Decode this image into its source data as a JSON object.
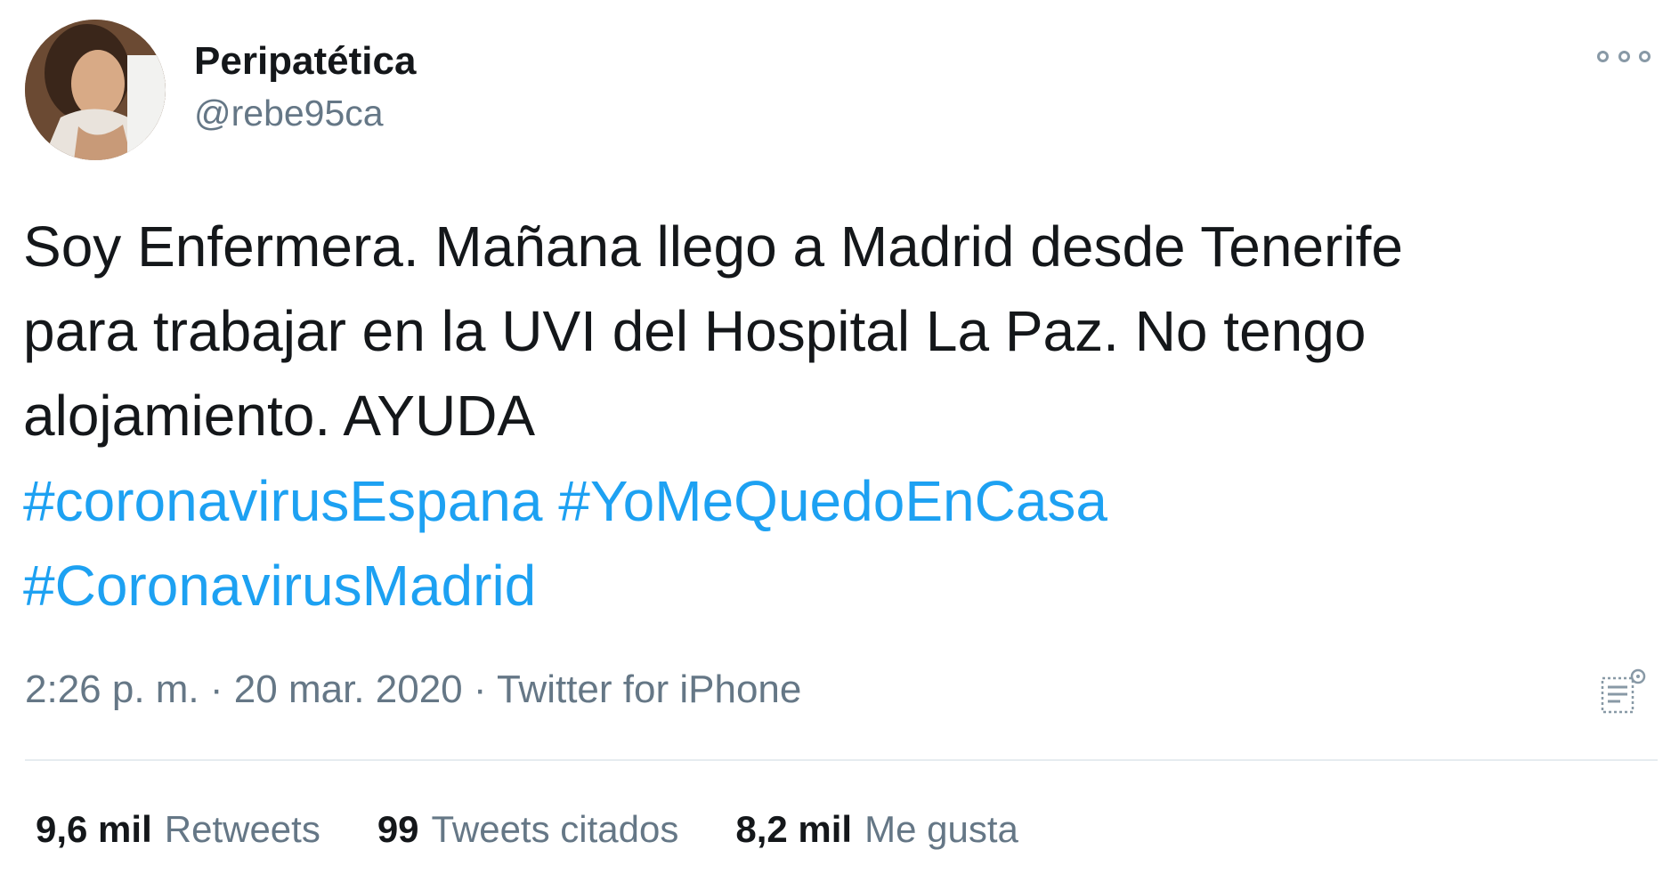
{
  "author": {
    "display_name": "Peripatética",
    "handle": "@rebe95ca"
  },
  "icons": {
    "more": "more-options-icon",
    "analytics": "analytics-icon"
  },
  "tweet": {
    "text_lines": [
      "Soy Enfermera. Mañana llego a Madrid desde Tenerife",
      "para trabajar en la UVI del Hospital La Paz. No tengo",
      "alojamiento. AYUDA"
    ],
    "hashtags": [
      "#coronavirusEspana",
      "#YoMeQuedoEnCasa",
      "#CoronavirusMadrid"
    ]
  },
  "meta": {
    "time": "2:26 p. m.",
    "separator": "·",
    "date": "20 mar. 2020",
    "source": "Twitter for iPhone"
  },
  "stats": [
    {
      "value": "9,6 mil",
      "label": "Retweets"
    },
    {
      "value": "99",
      "label": "Tweets citados"
    },
    {
      "value": "8,2 mil",
      "label": "Me gusta"
    }
  ],
  "colors": {
    "text": "#14171a",
    "secondary": "#657786",
    "link": "#1da1f2",
    "divider": "#e6ecf0"
  }
}
